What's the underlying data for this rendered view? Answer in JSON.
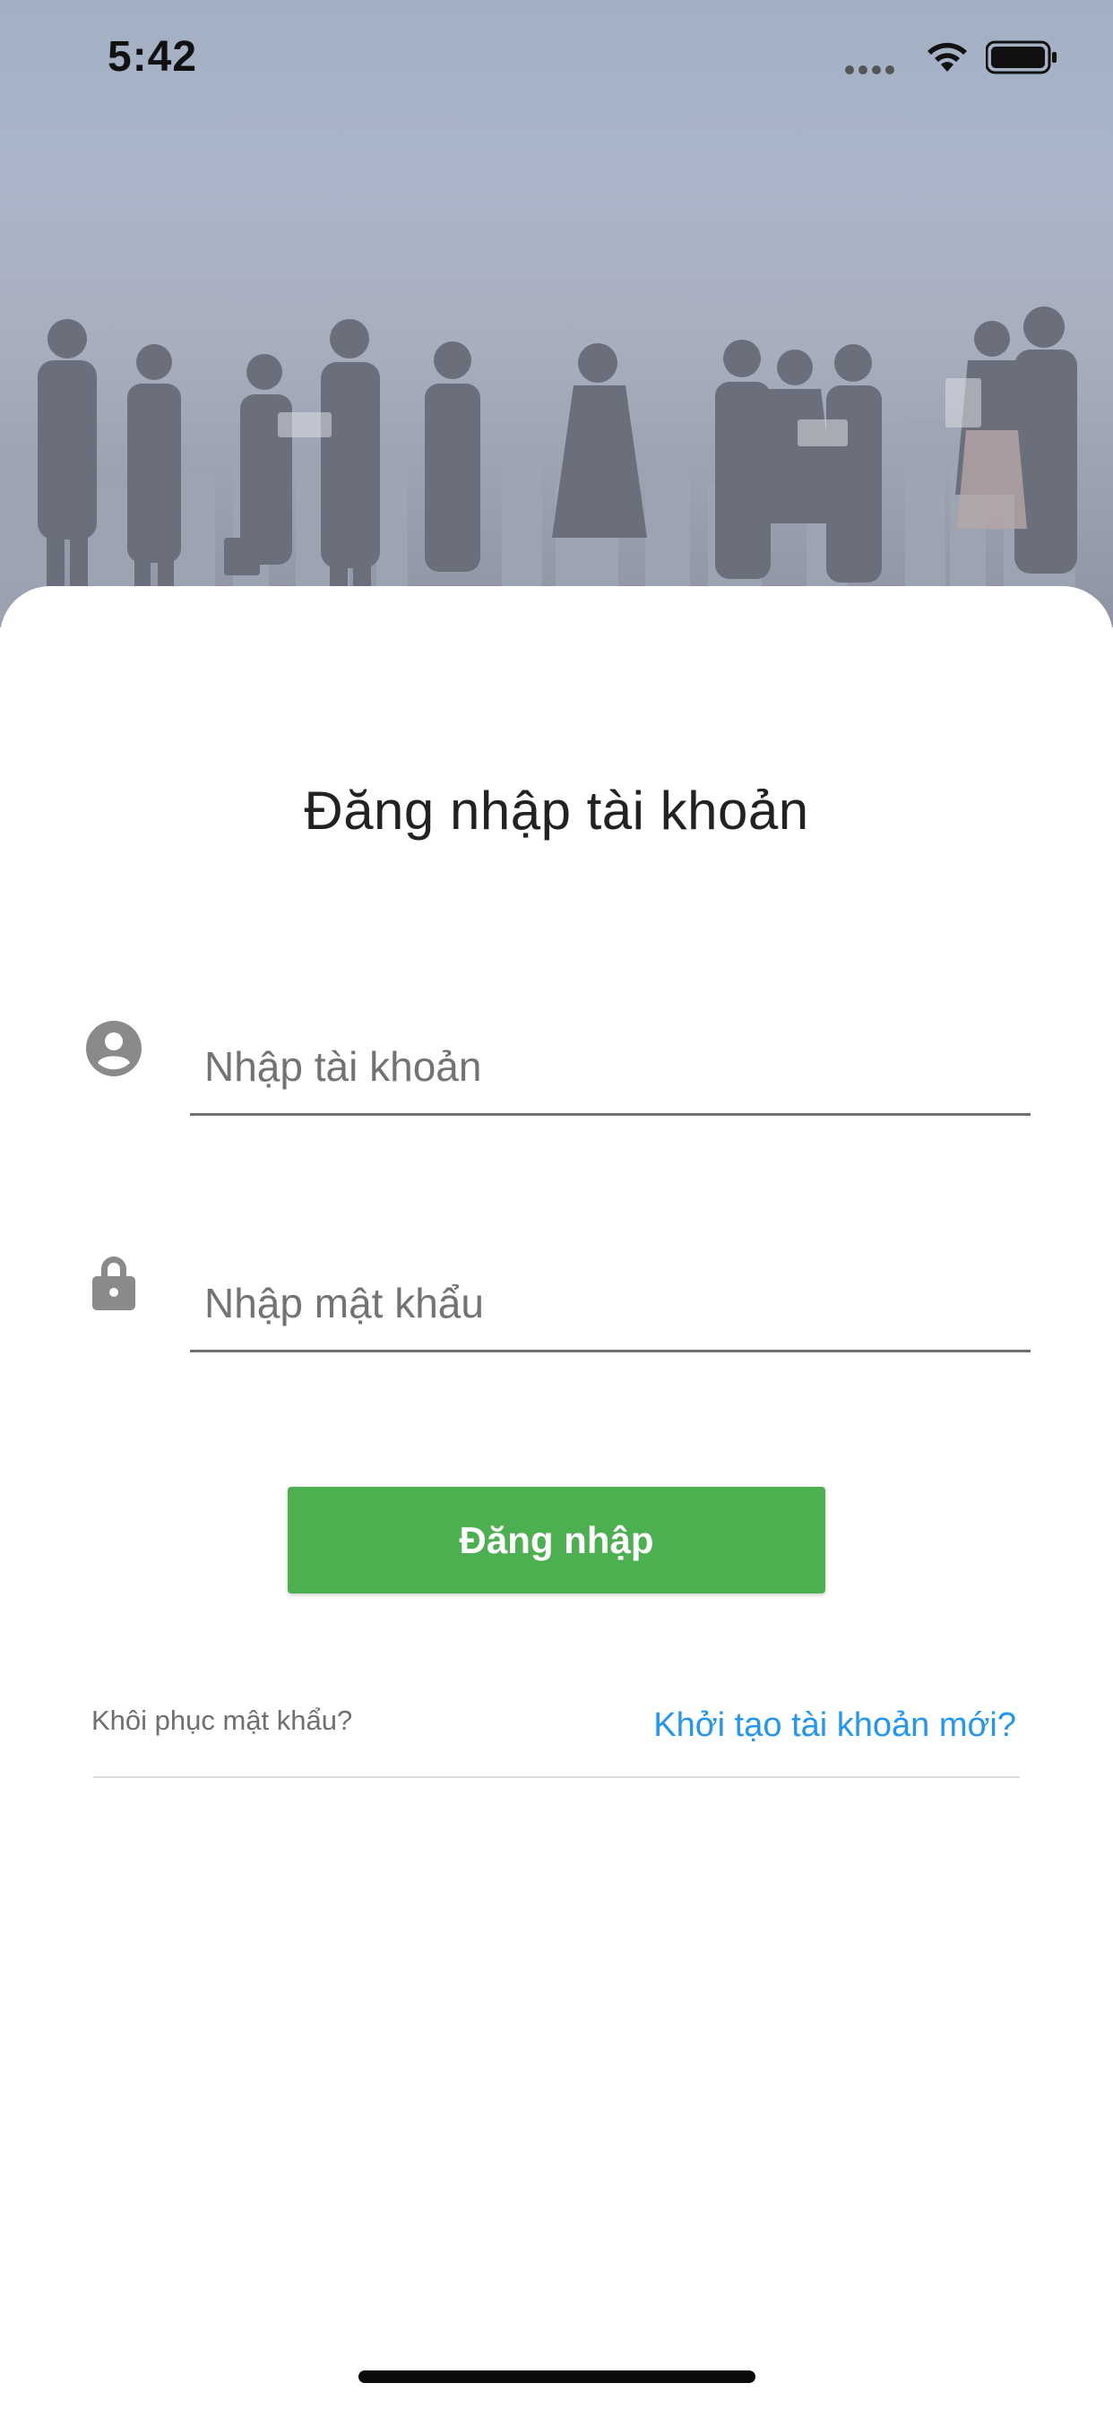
{
  "status_bar": {
    "time": "5:42"
  },
  "hero": {
    "image": "business-people-silhouettes-city-skyline"
  },
  "login": {
    "title": "Đăng nhập tài khoản",
    "username": {
      "placeholder": "Nhập tài khoản",
      "value": "",
      "icon": "account-circle-icon"
    },
    "password": {
      "placeholder": "Nhập mật khẩu",
      "value": "",
      "icon": "lock-icon"
    },
    "submit_label": "Đăng nhập",
    "recover_password_label": "Khôi phục mật khẩu?",
    "create_account_label": "Khởi tạo tài khoản mới?"
  },
  "colors": {
    "primary_button": "#4caf50",
    "link": "#2196f3",
    "icon_gray": "#8a8a8a",
    "title_text": "#222222"
  }
}
